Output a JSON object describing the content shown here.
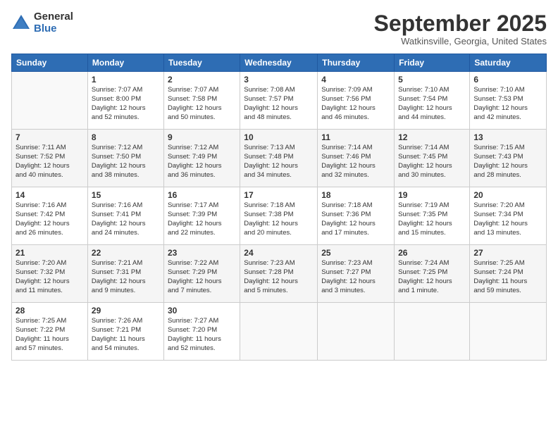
{
  "logo": {
    "general": "General",
    "blue": "Blue"
  },
  "title": "September 2025",
  "location": "Watkinsville, Georgia, United States",
  "days_header": [
    "Sunday",
    "Monday",
    "Tuesday",
    "Wednesday",
    "Thursday",
    "Friday",
    "Saturday"
  ],
  "weeks": [
    [
      {
        "num": "",
        "info": ""
      },
      {
        "num": "1",
        "info": "Sunrise: 7:07 AM\nSunset: 8:00 PM\nDaylight: 12 hours\nand 52 minutes."
      },
      {
        "num": "2",
        "info": "Sunrise: 7:07 AM\nSunset: 7:58 PM\nDaylight: 12 hours\nand 50 minutes."
      },
      {
        "num": "3",
        "info": "Sunrise: 7:08 AM\nSunset: 7:57 PM\nDaylight: 12 hours\nand 48 minutes."
      },
      {
        "num": "4",
        "info": "Sunrise: 7:09 AM\nSunset: 7:56 PM\nDaylight: 12 hours\nand 46 minutes."
      },
      {
        "num": "5",
        "info": "Sunrise: 7:10 AM\nSunset: 7:54 PM\nDaylight: 12 hours\nand 44 minutes."
      },
      {
        "num": "6",
        "info": "Sunrise: 7:10 AM\nSunset: 7:53 PM\nDaylight: 12 hours\nand 42 minutes."
      }
    ],
    [
      {
        "num": "7",
        "info": "Sunrise: 7:11 AM\nSunset: 7:52 PM\nDaylight: 12 hours\nand 40 minutes."
      },
      {
        "num": "8",
        "info": "Sunrise: 7:12 AM\nSunset: 7:50 PM\nDaylight: 12 hours\nand 38 minutes."
      },
      {
        "num": "9",
        "info": "Sunrise: 7:12 AM\nSunset: 7:49 PM\nDaylight: 12 hours\nand 36 minutes."
      },
      {
        "num": "10",
        "info": "Sunrise: 7:13 AM\nSunset: 7:48 PM\nDaylight: 12 hours\nand 34 minutes."
      },
      {
        "num": "11",
        "info": "Sunrise: 7:14 AM\nSunset: 7:46 PM\nDaylight: 12 hours\nand 32 minutes."
      },
      {
        "num": "12",
        "info": "Sunrise: 7:14 AM\nSunset: 7:45 PM\nDaylight: 12 hours\nand 30 minutes."
      },
      {
        "num": "13",
        "info": "Sunrise: 7:15 AM\nSunset: 7:43 PM\nDaylight: 12 hours\nand 28 minutes."
      }
    ],
    [
      {
        "num": "14",
        "info": "Sunrise: 7:16 AM\nSunset: 7:42 PM\nDaylight: 12 hours\nand 26 minutes."
      },
      {
        "num": "15",
        "info": "Sunrise: 7:16 AM\nSunset: 7:41 PM\nDaylight: 12 hours\nand 24 minutes."
      },
      {
        "num": "16",
        "info": "Sunrise: 7:17 AM\nSunset: 7:39 PM\nDaylight: 12 hours\nand 22 minutes."
      },
      {
        "num": "17",
        "info": "Sunrise: 7:18 AM\nSunset: 7:38 PM\nDaylight: 12 hours\nand 20 minutes."
      },
      {
        "num": "18",
        "info": "Sunrise: 7:18 AM\nSunset: 7:36 PM\nDaylight: 12 hours\nand 17 minutes."
      },
      {
        "num": "19",
        "info": "Sunrise: 7:19 AM\nSunset: 7:35 PM\nDaylight: 12 hours\nand 15 minutes."
      },
      {
        "num": "20",
        "info": "Sunrise: 7:20 AM\nSunset: 7:34 PM\nDaylight: 12 hours\nand 13 minutes."
      }
    ],
    [
      {
        "num": "21",
        "info": "Sunrise: 7:20 AM\nSunset: 7:32 PM\nDaylight: 12 hours\nand 11 minutes."
      },
      {
        "num": "22",
        "info": "Sunrise: 7:21 AM\nSunset: 7:31 PM\nDaylight: 12 hours\nand 9 minutes."
      },
      {
        "num": "23",
        "info": "Sunrise: 7:22 AM\nSunset: 7:29 PM\nDaylight: 12 hours\nand 7 minutes."
      },
      {
        "num": "24",
        "info": "Sunrise: 7:23 AM\nSunset: 7:28 PM\nDaylight: 12 hours\nand 5 minutes."
      },
      {
        "num": "25",
        "info": "Sunrise: 7:23 AM\nSunset: 7:27 PM\nDaylight: 12 hours\nand 3 minutes."
      },
      {
        "num": "26",
        "info": "Sunrise: 7:24 AM\nSunset: 7:25 PM\nDaylight: 12 hours\nand 1 minute."
      },
      {
        "num": "27",
        "info": "Sunrise: 7:25 AM\nSunset: 7:24 PM\nDaylight: 11 hours\nand 59 minutes."
      }
    ],
    [
      {
        "num": "28",
        "info": "Sunrise: 7:25 AM\nSunset: 7:22 PM\nDaylight: 11 hours\nand 57 minutes."
      },
      {
        "num": "29",
        "info": "Sunrise: 7:26 AM\nSunset: 7:21 PM\nDaylight: 11 hours\nand 54 minutes."
      },
      {
        "num": "30",
        "info": "Sunrise: 7:27 AM\nSunset: 7:20 PM\nDaylight: 11 hours\nand 52 minutes."
      },
      {
        "num": "",
        "info": ""
      },
      {
        "num": "",
        "info": ""
      },
      {
        "num": "",
        "info": ""
      },
      {
        "num": "",
        "info": ""
      }
    ]
  ]
}
